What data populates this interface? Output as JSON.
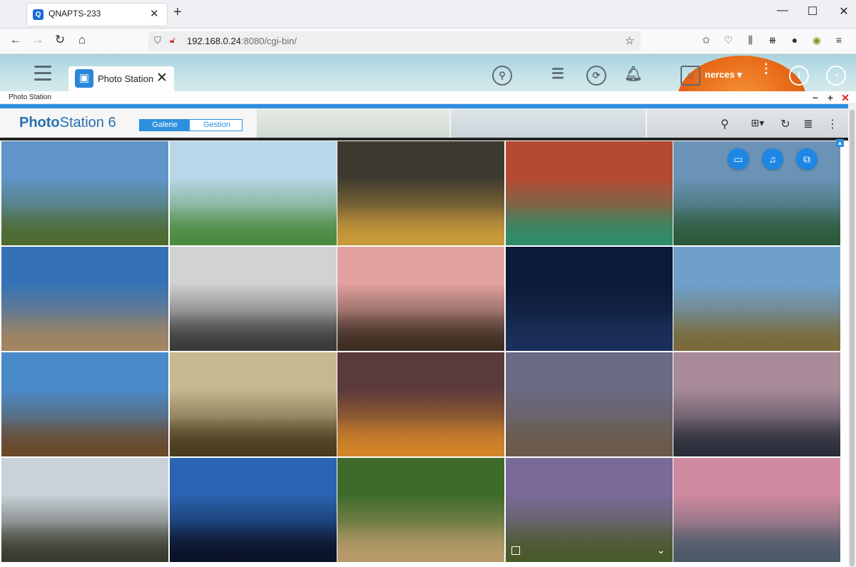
{
  "browser": {
    "tab_title": "QNAPTS-233",
    "tab_favicon": "qnap-favicon",
    "url_host": "192.168.0.24",
    "url_rest": ":8080/cgi-bin/",
    "new_tab": "+",
    "win_min": "—",
    "win_max": "☐",
    "win_close": "✕"
  },
  "nas": {
    "app_tab_title": "Photo Station",
    "username": "nerces ▾"
  },
  "window": {
    "title": "Photo Station",
    "ctrl_min": "−",
    "ctrl_max": "+",
    "ctrl_close": "✕"
  },
  "photostation": {
    "logo_photo": "Photo",
    "logo_station": "Station 6",
    "tab_galerie": "Galerie",
    "tab_gestion": "Gestion"
  },
  "colors": {
    "accent": "#2e8fe0",
    "close_red": "#e02020"
  },
  "photos": [
    {
      "name": "lighthouse-coast",
      "top": "#5f95c9",
      "bottom": "#4e6a2e"
    },
    {
      "name": "fantasy-cliffs-parrot",
      "top": "#b8d7e8",
      "bottom": "#4c8a3e"
    },
    {
      "name": "dramatic-clouds-sunset",
      "top": "#3d3a30",
      "bottom": "#c99a3a"
    },
    {
      "name": "venice-canal",
      "top": "#b54a32",
      "bottom": "#2f8c68"
    },
    {
      "name": "lake-forest-reflection",
      "top": "#6b93b8",
      "bottom": "#2c5a3a"
    },
    {
      "name": "fishing-boats-beach",
      "top": "#3572b5",
      "bottom": "#a38560"
    },
    {
      "name": "moon-floating-islands",
      "top": "#d2d2d2",
      "bottom": "#3b3b3b"
    },
    {
      "name": "japanese-pagoda",
      "top": "#e2a2a0",
      "bottom": "#3e2e22"
    },
    {
      "name": "fireworks-night",
      "top": "#0b1a36",
      "bottom": "#1b2f5a"
    },
    {
      "name": "mountain-lake",
      "top": "#6fa0cc",
      "bottom": "#7a6a3a"
    },
    {
      "name": "lakeside-bench",
      "top": "#4a8ac8",
      "bottom": "#6a4a2a"
    },
    {
      "name": "twisted-tree-sunset",
      "top": "#c8b890",
      "bottom": "#4a3a1e"
    },
    {
      "name": "sunset-clouds-orange",
      "top": "#5a3a3a",
      "bottom": "#d28428"
    },
    {
      "name": "rocky-shore-waves",
      "top": "#6a6a82",
      "bottom": "#6a5a4a"
    },
    {
      "name": "pink-dusk-rainbow",
      "top": "#a88a98",
      "bottom": "#2a2e3a"
    },
    {
      "name": "foggy-coast-hills",
      "top": "#c8d2d8",
      "bottom": "#3a3a2e"
    },
    {
      "name": "blue-night-lake",
      "top": "#2b64b2",
      "bottom": "#0a1226"
    },
    {
      "name": "cheetah-grass",
      "top": "#3e6a2a",
      "bottom": "#b89a6a"
    },
    {
      "name": "tide-pools-sunset",
      "top": "#7a6a98",
      "bottom": "#4a5a2a"
    },
    {
      "name": "pink-sky-rocks",
      "top": "#d08aa0",
      "bottom": "#4a5a68"
    }
  ],
  "hover_actions": [
    {
      "icon": "monitor-icon",
      "glyph": "▭"
    },
    {
      "icon": "music-note-icon",
      "glyph": "♫"
    },
    {
      "icon": "slideshow-icon",
      "glyph": "⧉"
    }
  ]
}
